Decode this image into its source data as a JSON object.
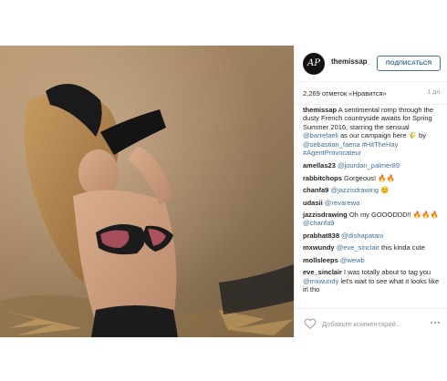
{
  "post": {
    "account": {
      "username": "themissap",
      "avatar_text": "AP"
    },
    "follow_label": "ПОДПИСАТЬСЯ",
    "likes_label": "2,269 отметок «Нравится»",
    "time_ago": "1 дн.",
    "caption": {
      "user": "themissap",
      "text_1": " A sentimental romp through the dusty French countryside awaits for Spring Summer 2016, starring the sensual ",
      "mention_1": "@barrefaeli",
      "text_2": " as our campaign here 🌾 by ",
      "mention_2": "@sebastian_faena",
      "text_3": " ",
      "tag_1": "#HitTheHay",
      "text_4": " ",
      "tag_2": "#AgentProvocateur"
    },
    "comments": [
      {
        "user": "amellas23",
        "text": " ",
        "mention": "@jourdan_palmer89",
        "after": ""
      },
      {
        "user": "rabbitchops",
        "text": " Gorgeous! 🔥🔥",
        "mention": "",
        "after": ""
      },
      {
        "user": "chanfa9",
        "text": " ",
        "mention": "@jazzisdrawing",
        "after": " 😊"
      },
      {
        "user": "udasii",
        "text": " ",
        "mention": "@revarewa",
        "after": ""
      },
      {
        "user": "jazzisdrawing",
        "text": " Oh my GOOODDD!! 🔥🔥🔥",
        "mention": "",
        "after": ""
      },
      {
        "user": "",
        "text": "",
        "mention": "@chanfa9",
        "after": ""
      },
      {
        "user": "prabhat838",
        "text": " ",
        "mention": "@dishapatani",
        "after": ""
      },
      {
        "user": "mxwundy",
        "text": " ",
        "mention": "@eve_sinclair",
        "after": " this kinda cute"
      },
      {
        "user": "mollsleeps",
        "text": " ",
        "mention": "@wewb",
        "after": ""
      },
      {
        "user": "eve_sinclair",
        "text": " I was totally about to tag you ",
        "mention": "@mxwundy",
        "after": " let's wait to see what it looks like irl tho"
      }
    ],
    "comment_placeholder": "Добавьте комментарий...",
    "icons": {
      "like": "heart-icon",
      "more": "more-options-icon"
    }
  }
}
